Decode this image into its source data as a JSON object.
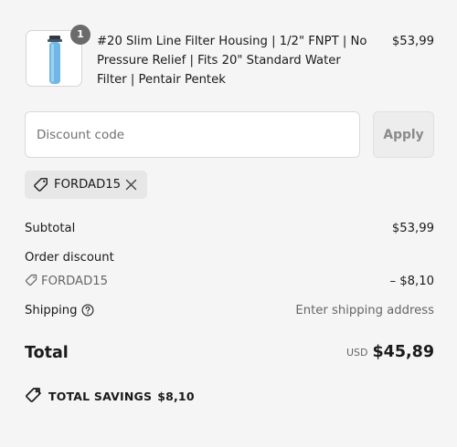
{
  "line_item": {
    "quantity": "1",
    "title": "#20 Slim Line Filter Housing | 1/2\" FNPT | No Pressure Relief | Fits 20\" Standard Water Filter | Pentair Pentek",
    "price": "$53,99",
    "image_icon": "filter-housing-image"
  },
  "discount": {
    "placeholder": "Discount code",
    "apply_label": "Apply",
    "applied_code": "FORDAD15"
  },
  "summary": {
    "subtotal_label": "Subtotal",
    "subtotal_value": "$53,99",
    "order_discount_label": "Order discount",
    "discount_code": "FORDAD15",
    "discount_value": "– $8,10",
    "shipping_label": "Shipping",
    "shipping_value": "Enter shipping address"
  },
  "total": {
    "label": "Total",
    "currency": "USD",
    "amount": "$45,89"
  },
  "savings": {
    "label": "TOTAL SAVINGS",
    "amount": "$8,10"
  },
  "colors": {
    "background": "#f5f5f5",
    "chip": "#e7e7e7",
    "badge": "#6b6b6b",
    "filter_blue": "#6fb8e6"
  }
}
